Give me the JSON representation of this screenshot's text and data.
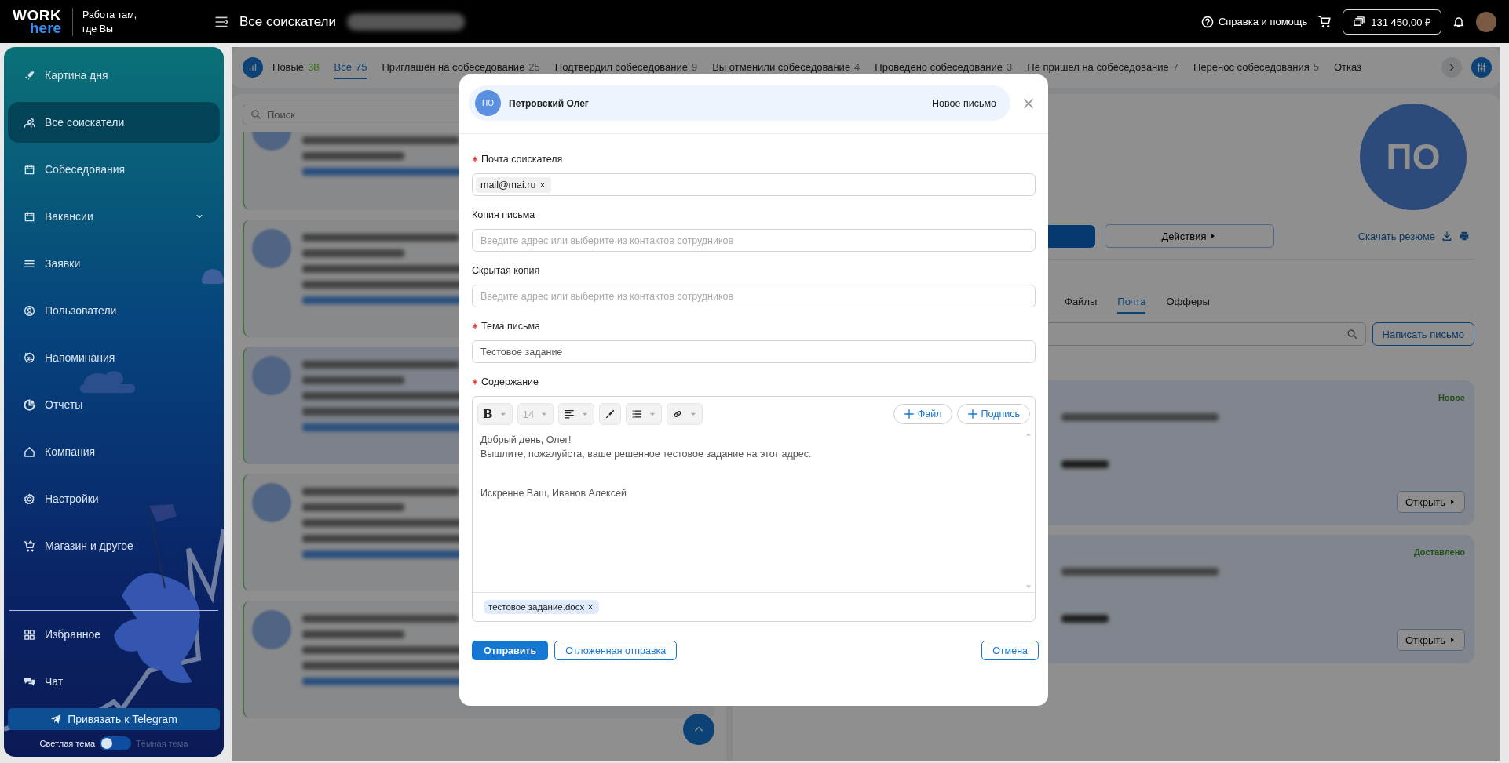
{
  "topbar": {
    "logo_top": "WORK",
    "logo_bottom": "here",
    "tagline": [
      "Работа там,",
      "где Вы"
    ],
    "title": "Все соискатели",
    "help": "Справка и помощь",
    "balance": "131 450,00 ₽"
  },
  "sidebar": {
    "items": [
      {
        "label": "Картина дня",
        "selected": false,
        "expandable": false
      },
      {
        "label": "Все соискатели",
        "selected": true,
        "expandable": false
      },
      {
        "label": "Собеседования",
        "selected": false,
        "expandable": false
      },
      {
        "label": "Вакансии",
        "selected": false,
        "expandable": true
      },
      {
        "label": "Заявки",
        "selected": false,
        "expandable": false
      },
      {
        "label": "Пользователи",
        "selected": false,
        "expandable": false
      },
      {
        "label": "Напоминания",
        "selected": false,
        "expandable": false
      },
      {
        "label": "Отчеты",
        "selected": false,
        "expandable": false
      },
      {
        "label": "Компания",
        "selected": false,
        "expandable": false
      },
      {
        "label": "Настройки",
        "selected": false,
        "expandable": false
      },
      {
        "label": "Магазин и другое",
        "selected": false,
        "expandable": false
      }
    ],
    "bottom_items": [
      {
        "label": "Избранное",
        "selected": false
      },
      {
        "label": "Чат",
        "selected": false
      }
    ],
    "telegram_button": "Привязать к Telegram",
    "theme": {
      "light_label": "Светлая тема",
      "dark_label": "Тёмная тема",
      "dark_selected": false
    }
  },
  "status_tabs": [
    {
      "kind": "new",
      "label": "Новые",
      "count": "38",
      "selected": false
    },
    {
      "kind": "all",
      "label": "Все",
      "count": "75",
      "selected": true
    },
    {
      "kind": "status",
      "label": "Приглашён на собеседование",
      "count": "25",
      "selected": false
    },
    {
      "kind": "status",
      "label": "Подтвердил собеседование",
      "count": "9",
      "selected": false
    },
    {
      "kind": "status",
      "label": "Вы отменили собеседование",
      "count": "4",
      "selected": false
    },
    {
      "kind": "status",
      "label": "Проведено собеседование",
      "count": "3",
      "selected": false
    },
    {
      "kind": "status",
      "label": "Не пришел на собеседование",
      "count": "7",
      "selected": false
    },
    {
      "kind": "status",
      "label": "Перенос собеседования",
      "count": "5",
      "selected": false
    },
    {
      "label": "Отказ",
      "selected": false
    }
  ],
  "candidate_search": {
    "placeholder": "Поиск"
  },
  "candidates": [
    {
      "selected": false
    },
    {
      "selected": false
    },
    {
      "selected": true
    },
    {
      "selected": false
    },
    {
      "selected": false
    }
  ],
  "profile": {
    "initials": "ПО",
    "actions_button": "Действия",
    "download_link": "Скачать резюме",
    "tabs": [
      {
        "label": "Файлы",
        "selected": false
      },
      {
        "label": "Почта",
        "selected": true
      },
      {
        "label": "Офферы",
        "selected": false
      }
    ],
    "write_button": "Написать письмо",
    "mails": [
      {
        "status": "Новое",
        "open_button": "Открыть"
      },
      {
        "status": "Доставлено",
        "open_button": "Открыть"
      }
    ]
  },
  "modal": {
    "initials": "ПО",
    "name": "Петровский Олег",
    "title": "Новое письмо",
    "fields": [
      {
        "kind": "chips",
        "label": "Почта соискателя",
        "required": true,
        "chips": [
          "mail@mai.ru"
        ]
      },
      {
        "kind": "input",
        "label": "Копия письма",
        "required": false,
        "placeholder": "Введите адрес или выберите из контактов сотрудников"
      },
      {
        "kind": "input",
        "label": "Скрытая копия",
        "required": false,
        "placeholder": "Введите адрес или выберите из контактов сотрудников"
      },
      {
        "kind": "input",
        "label": "Тема письма",
        "required": true,
        "value": "Тестовое задание"
      }
    ],
    "content": {
      "label": "Содержание",
      "required": true,
      "bold_button": "B",
      "font_size": {
        "text": "14",
        "disabled": true
      },
      "file_button": "Файл",
      "signature_button": "Подпись",
      "greeting": [
        "Добрый день, Олег!",
        "Вышлите, пожалуйста, ваше решенное тестовое задание на этот адрес."
      ],
      "signature": "Искренне Ваш, Иванов Алексей",
      "attachments": [
        "тестовое задание.docx"
      ]
    },
    "send_button": "Отправить",
    "delayed_button": "Отложенная отправка",
    "cancel_button": "Отмена"
  }
}
